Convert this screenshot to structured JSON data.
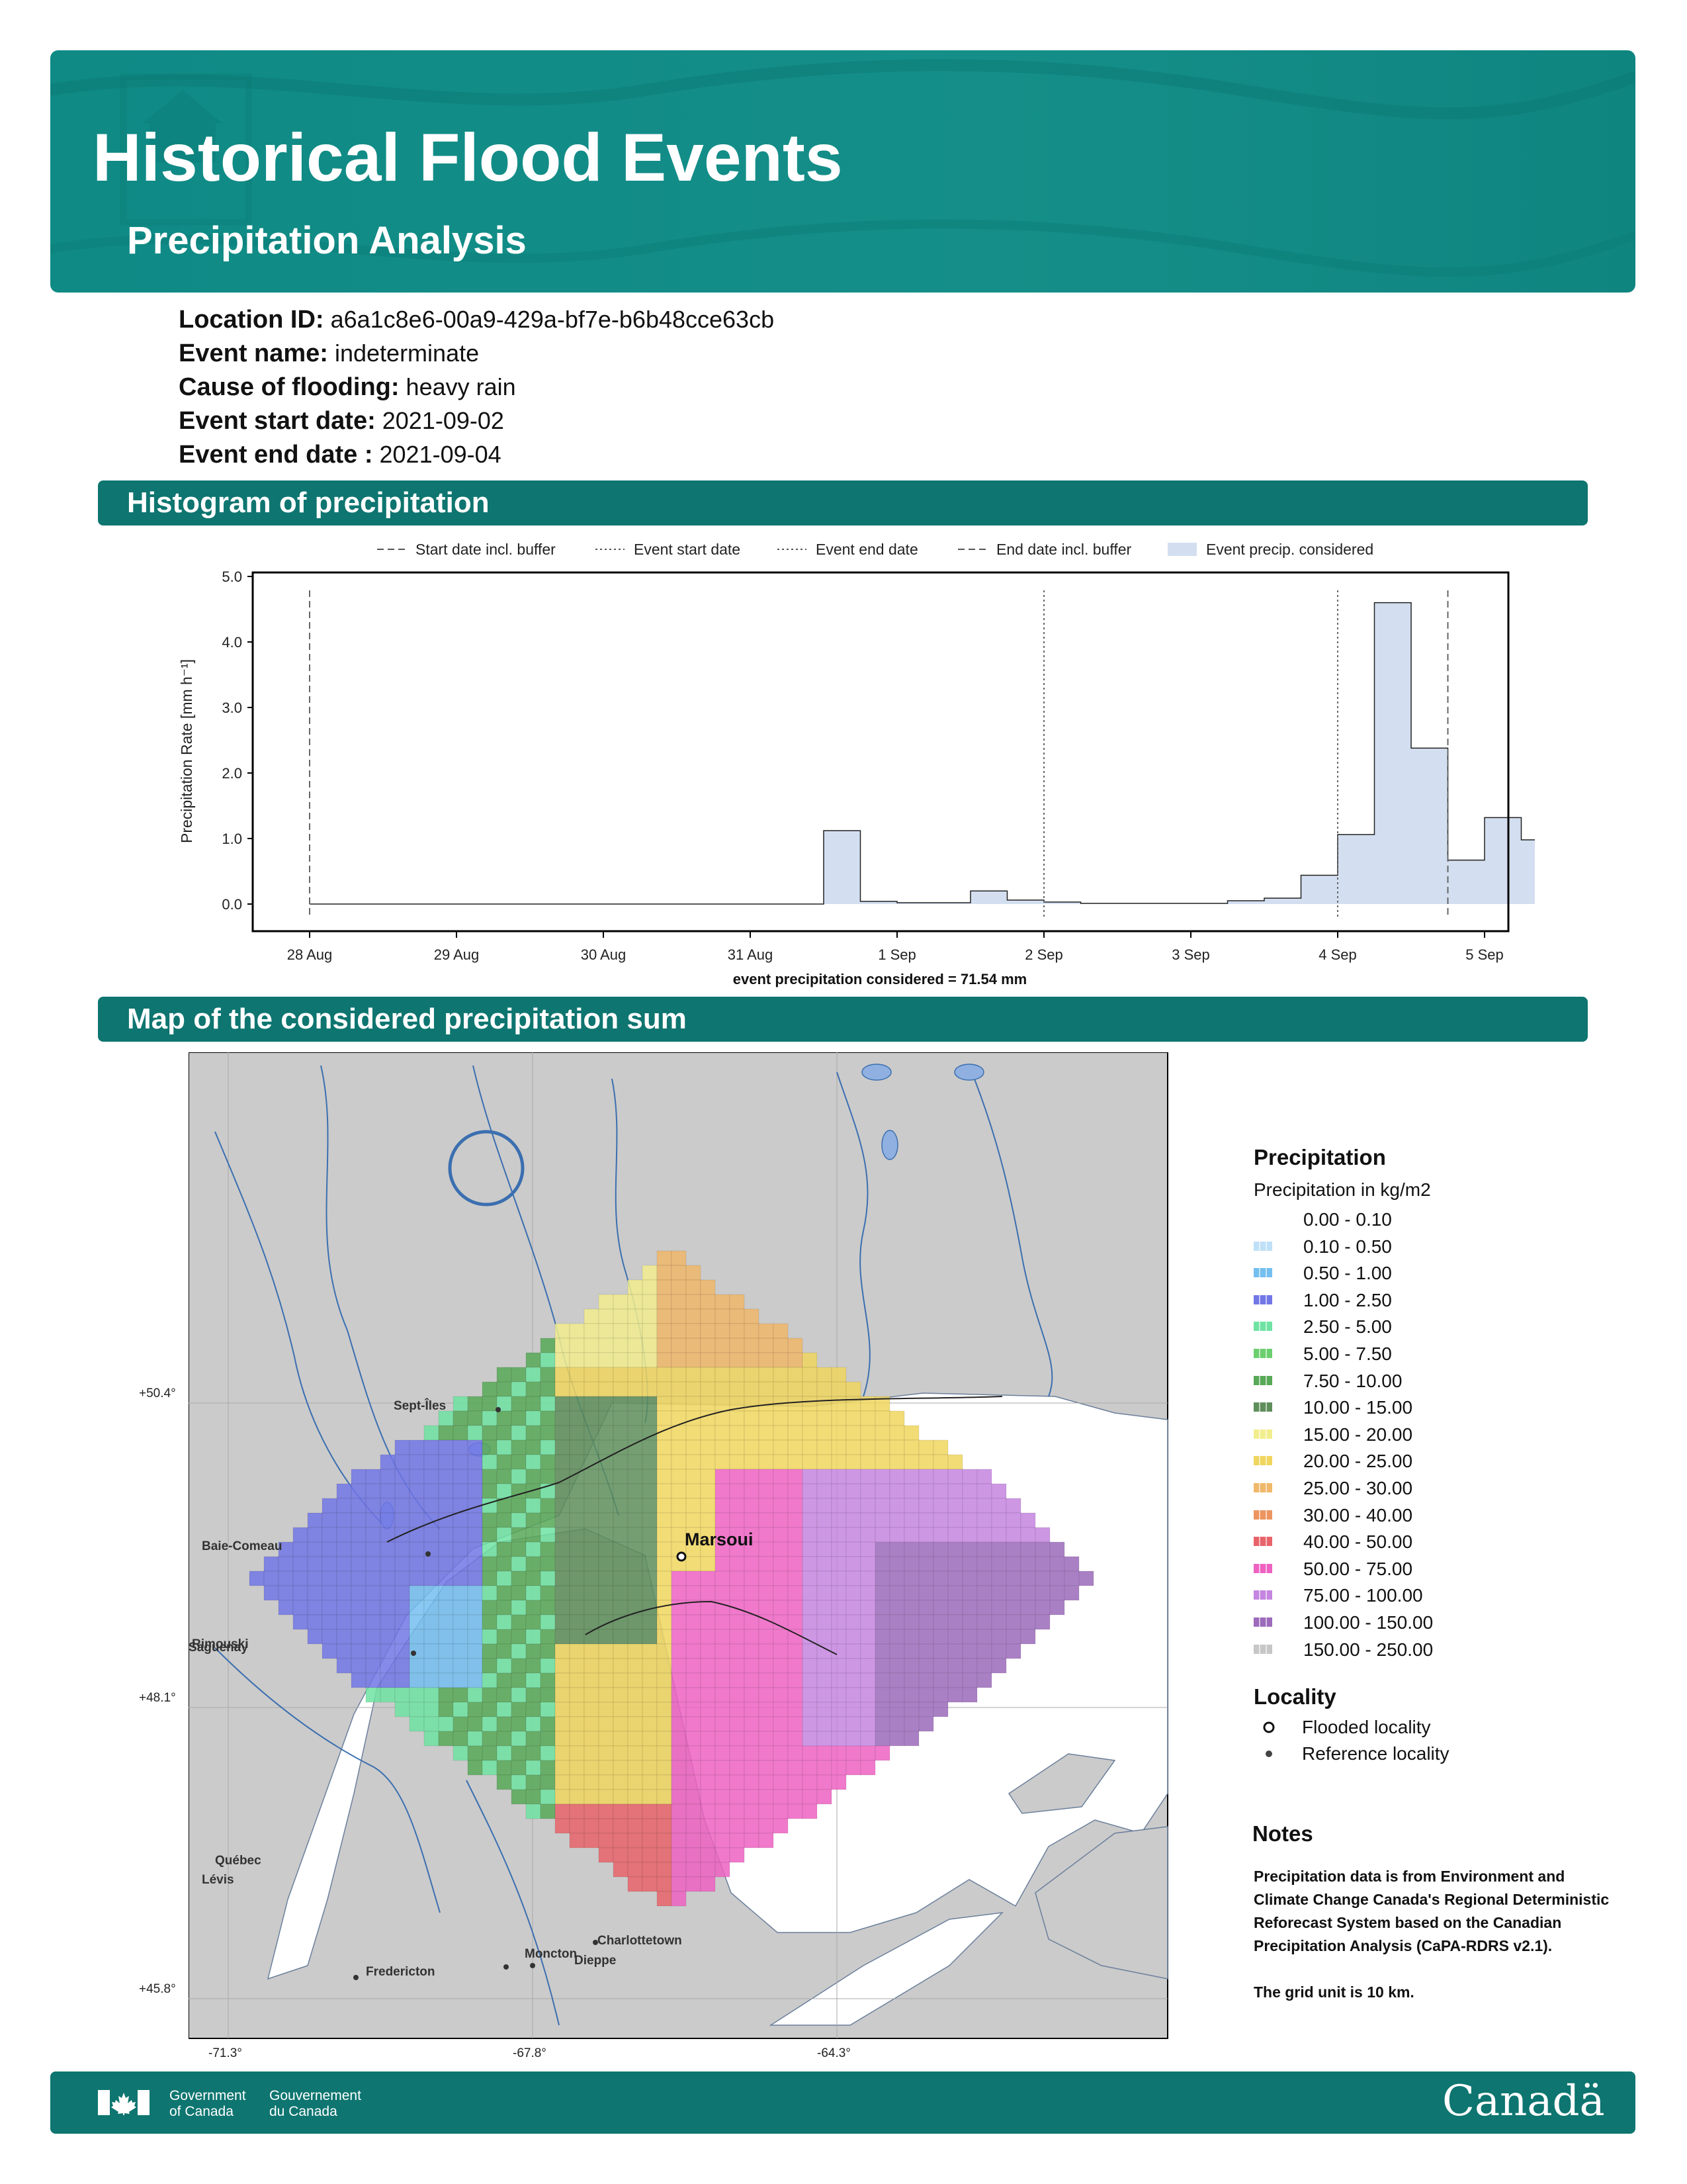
{
  "header": {
    "title": "Historical Flood Events",
    "subtitle": "Precipitation Analysis",
    "band_color": "#10898a"
  },
  "meta": [
    {
      "label": "Location ID:",
      "value": "a6a1c8e6-00a9-429a-bf7e-b6b48cce63cb"
    },
    {
      "label": "Event name:",
      "value": "indeterminate"
    },
    {
      "label": "Cause of flooding:",
      "value": "heavy rain"
    },
    {
      "label": "Event start date:",
      "value": "2021-09-02"
    },
    {
      "label": "Event end date :",
      "value": "2021-09-04"
    }
  ],
  "sections": {
    "histogram": "Histogram of precipitation",
    "map": "Map of the considered precipitation sum"
  },
  "chart_data": {
    "type": "bar",
    "ylabel": "Precipitation Rate [mm h⁻¹]",
    "xlabel": "event precipitation considered = 71.54 mm",
    "ylim": [
      0,
      5.0
    ],
    "yticks": [
      "0.0",
      "1.0",
      "2.0",
      "3.0",
      "4.0",
      "5.0"
    ],
    "xticks": [
      "28 Aug",
      "29 Aug",
      "30 Aug",
      "31 Aug",
      "1 Sep",
      "2 Sep",
      "3 Sep",
      "4 Sep",
      "5 Sep"
    ],
    "legend": [
      {
        "label": "Start date incl. buffer",
        "style": "dashed"
      },
      {
        "label": "Event start date",
        "style": "dotted"
      },
      {
        "label": "Event end date",
        "style": "dotted"
      },
      {
        "label": "End date incl. buffer",
        "style": "dashed"
      },
      {
        "label": "Event precip. considered",
        "style": "patch"
      }
    ],
    "legend_position": "top",
    "step_width_days": 0.25,
    "series_start": "2021-08-28",
    "values": [
      0,
      0,
      0,
      0,
      0,
      0,
      0,
      0,
      0,
      0,
      0,
      0,
      0,
      0,
      1.12,
      0.04,
      0.02,
      0.02,
      0.2,
      0.06,
      0.03,
      0.01,
      0.01,
      0.01,
      0.01,
      0.05,
      0.09,
      0.44,
      1.06,
      4.6,
      2.38,
      0.67,
      1.32,
      0.98,
      0.22
    ],
    "markers": {
      "start_buffer": "2021-08-28",
      "event_start": "2021-09-02",
      "event_end": "2021-09-04",
      "end_buffer": "2021-09-04 18:00"
    },
    "fill_color": "#d3dff0",
    "line_color": "#222222"
  },
  "map": {
    "flooded_locality": "Marsoui",
    "places": [
      "Sept-Îles",
      "Baie-Comeau",
      "Rimouski",
      "Saguenay",
      "Québec",
      "Lévis",
      "Fredericton",
      "Moncton",
      "Dieppe",
      "Charlottetown"
    ],
    "lat_labels": [
      "+50.4°",
      "+48.1°",
      "+45.8°"
    ],
    "lon_labels": [
      "-71.3°",
      "-67.8°",
      "-64.3°"
    ]
  },
  "legend": {
    "title": "Precipitation",
    "subtitle": "Precipitation in kg/m2",
    "classes": [
      {
        "label": "0.00 - 0.10",
        "color": "#ffffff"
      },
      {
        "label": "0.10 - 0.50",
        "color": "#bfe0f7"
      },
      {
        "label": "0.50 - 1.00",
        "color": "#74bff0"
      },
      {
        "label": "1.00 - 2.50",
        "color": "#7277e6"
      },
      {
        "label": "2.50 - 5.00",
        "color": "#6fe3a3"
      },
      {
        "label": "5.00 - 7.50",
        "color": "#6ccf6f"
      },
      {
        "label": "7.50 - 10.00",
        "color": "#58a957"
      },
      {
        "label": "10.00 - 15.00",
        "color": "#5e8f5b"
      },
      {
        "label": "15.00 - 20.00",
        "color": "#f2ee8e"
      },
      {
        "label": "20.00 - 25.00",
        "color": "#f0d65f"
      },
      {
        "label": "25.00 - 30.00",
        "color": "#f0b86a"
      },
      {
        "label": "30.00 - 40.00",
        "color": "#ec9560"
      },
      {
        "label": "40.00 - 50.00",
        "color": "#e8646a"
      },
      {
        "label": "50.00 - 75.00",
        "color": "#ee62c2"
      },
      {
        "label": "75.00 - 100.00",
        "color": "#c585e0"
      },
      {
        "label": "100.00 - 150.00",
        "color": "#9c6bbb"
      },
      {
        "label": "150.00 - 250.00",
        "color": "#c7c7c7"
      }
    ],
    "locality_title": "Locality",
    "flooded_label": "Flooded locality",
    "reference_label": "Reference locality",
    "notes_title": "Notes",
    "notes_1": "Precipitation data is from Environment and Climate Change Canada's Regional Deterministic Reforecast System based on the Canadian Precipitation Analysis (CaPA-RDRS v2.1).",
    "notes_2": "The grid unit is 10 km."
  },
  "footer": {
    "gov_en_1": "Government",
    "gov_en_2": "of Canada",
    "gov_fr_1": "Gouvernement",
    "gov_fr_2": "du Canada",
    "wordmark": "Canadä"
  }
}
